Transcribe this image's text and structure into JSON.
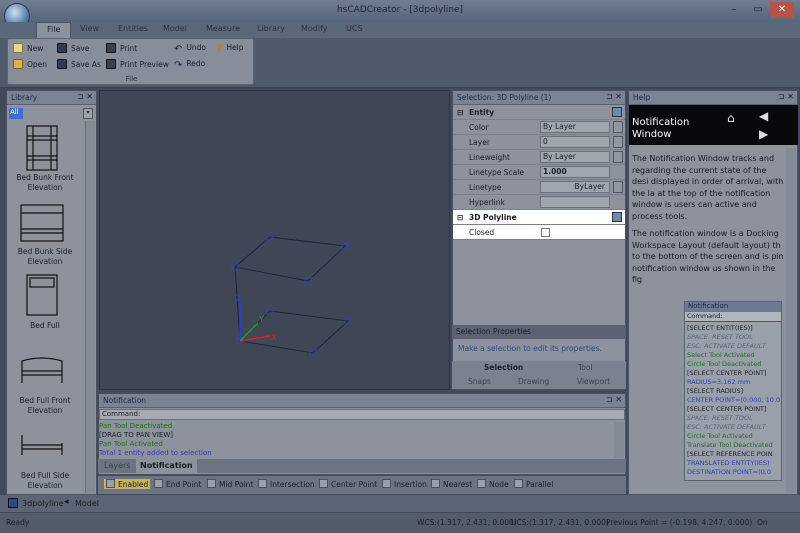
{
  "window": {
    "title": "hsCADCreator - [3dpolyline]",
    "min": "–",
    "max": "▭",
    "close": "✕"
  },
  "ribbon": {
    "tabs": [
      "File",
      "View",
      "Entities",
      "Model",
      "Measure",
      "Library",
      "Modify",
      "UCS"
    ],
    "group_label": "File",
    "buttons": {
      "new": "New",
      "open": "Open",
      "save": "Save",
      "save_as": "Save As",
      "print": "Print",
      "print_preview": "Print Preview",
      "undo": "Undo",
      "redo": "Redo",
      "help": "Help"
    }
  },
  "library": {
    "title": "Library",
    "filter": "All",
    "items": [
      "Bed Bunk Front Elevation",
      "Bed Bunk Side Elevation",
      "Bed Full",
      "Bed Full Front Elevation",
      "Bed Full Side Elevation"
    ]
  },
  "properties": {
    "title": "Selection: 3D Polyline (1)",
    "entity_header": "Entity",
    "rows": [
      {
        "key": "Color",
        "value": "By Layer"
      },
      {
        "key": "Layer",
        "value": "0"
      },
      {
        "key": "Lineweight",
        "value": "By Layer"
      },
      {
        "key": "Linetype Scale",
        "value": "1.000"
      },
      {
        "key": "Linetype",
        "value": "ByLayer"
      },
      {
        "key": "Hyperlink",
        "value": ""
      }
    ],
    "poly_header": "3D Polyline",
    "poly_rows": [
      {
        "key": "Closed",
        "value": ""
      }
    ],
    "footer_title": "Selection Properties",
    "footer_msg": "Make a selection to edit its properties.",
    "tabs": [
      "Selection",
      "Tool",
      "Snaps",
      "Drawing",
      "Viewport"
    ]
  },
  "help": {
    "title": "Help",
    "banner_title": "Notification Window",
    "body": "The Notification Window tracks and regarding the current state of the desi displayed in order of arrival, with the la at the top of the notification window is users can active and process tools.",
    "body2": "The notification window is a Docking Workspace Layout (default layout) th to the bottom of the screen and is pin notification window us shown in the fig",
    "mini_title": "Notification",
    "mini_cmd": "Command:",
    "mini_lines": [
      {
        "t": "[SELECT ENTIT(IES)]",
        "c": "#1a1f29"
      },
      {
        "t": "SPACE: RESET TOOL",
        "c": "#5a6070"
      },
      {
        "t": "ESC: ACTIVATE DEFAULT",
        "c": "#5a6070"
      },
      {
        "t": "Select Tool Activated",
        "c": "#1f6b1f"
      },
      {
        "t": "Circle Tool Deactivated",
        "c": "#1f6b1f"
      },
      {
        "t": "[SELECT CENTER POINT]",
        "c": "#1a1f29"
      },
      {
        "t": "RADIUS=3.162 mm",
        "c": "#2d3fb0"
      },
      {
        "t": "[SELECT RADIUS]",
        "c": "#1a1f29"
      },
      {
        "t": "CENTER POINT=(0.000, 10.0",
        "c": "#2d3fb0"
      },
      {
        "t": "[SELECT CENTER POINT]",
        "c": "#1a1f29"
      },
      {
        "t": "SPACE: RESET TOOL",
        "c": "#5a6070"
      },
      {
        "t": "ESC: ACTIVATE DEFAULT",
        "c": "#5a6070"
      },
      {
        "t": "Circle Tool Activated",
        "c": "#1f6b1f"
      },
      {
        "t": "Translate Tool Deactivated",
        "c": "#1f6b1f"
      },
      {
        "t": "[SELECT REFERENCE POIN",
        "c": "#1a1f29"
      },
      {
        "t": "TRANSLATED ENTITY(IES)",
        "c": "#2d3fb0"
      },
      {
        "t": "DESTINATION POINT=(0.0",
        "c": "#2d3fb0"
      }
    ]
  },
  "notification": {
    "title": "Notification",
    "command": "Command:",
    "log": [
      {
        "t": "Pan Tool Deactivated",
        "c": "#1f6b1f"
      },
      {
        "t": "[DRAG TO PAN VIEW]",
        "c": "#1a1f29"
      },
      {
        "t": "Pan Tool Activated",
        "c": "#1f6b1f"
      },
      {
        "t": "Total 1 entity added to selection",
        "c": "#2d3fb0"
      }
    ],
    "tabs": [
      "Layers",
      "Notification"
    ]
  },
  "snaps": [
    "Enabled",
    "End Point",
    "Mid Point",
    "Intersection",
    "Center Point",
    "Insertion",
    "Nearest",
    "Node",
    "Parallel"
  ],
  "doc_tabs": {
    "doc": "3dpolyline",
    "model": "Model"
  },
  "status": {
    "ready": "Ready",
    "wcs": "WCS:(1.317, 2.431, 0.000)",
    "ucs": "UCS:(1.317, 2.431, 0.000)",
    "prev": "Previous Point = (-0.198, 4.247, 0.000)",
    "on": "On"
  },
  "colors": {
    "accent": "#3b6fd1",
    "selected_row": "#ffffff",
    "axis_x": "#e02020",
    "axis_y": "#20a020",
    "axis_z": "#2040e0"
  }
}
